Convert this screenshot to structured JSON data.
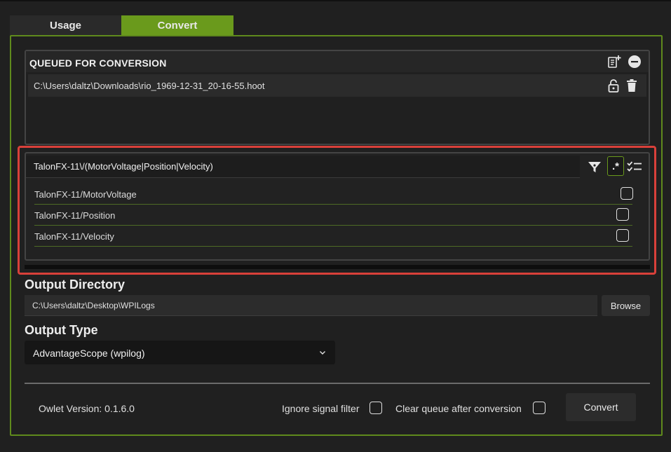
{
  "tabs": [
    {
      "label": "Usage",
      "active": false
    },
    {
      "label": "Convert",
      "active": true
    }
  ],
  "queue": {
    "title": "QUEUED FOR CONVERSION",
    "items": [
      {
        "path": "C:\\Users\\daltz\\Downloads\\rio_1969-12-31_20-16-55.hoot"
      }
    ],
    "header_icons": [
      "add-file-icon",
      "remove-all-icon"
    ],
    "row_icons": [
      "unlock-icon",
      "trash-icon"
    ]
  },
  "filter": {
    "value": "TalonFX-11\\/(MotorVoltage|Position|Velocity)",
    "icons": [
      "filter-funnel-icon",
      "regex-icon",
      "select-all-icon"
    ],
    "regex_label": ".*",
    "signals": [
      {
        "label": "TalonFX-11/MotorVoltage",
        "checked": false
      },
      {
        "label": "TalonFX-11/Position",
        "checked": false
      },
      {
        "label": "TalonFX-11/Velocity",
        "checked": false
      }
    ]
  },
  "output_directory": {
    "title": "Output Directory",
    "value": "C:\\Users\\daltz\\Desktop\\WPILogs",
    "browse_label": "Browse"
  },
  "output_type": {
    "title": "Output Type",
    "selected": "AdvantageScope (wpilog)"
  },
  "footer": {
    "version": "Owlet Version: 0.1.6.0",
    "ignore_filter_label": "Ignore signal filter",
    "ignore_filter_checked": false,
    "clear_queue_label": "Clear queue after conversion",
    "clear_queue_checked": false,
    "convert_label": "Convert"
  },
  "colors": {
    "accent": "#6a9a1c",
    "highlight": "#d9403a",
    "background": "#202020"
  }
}
